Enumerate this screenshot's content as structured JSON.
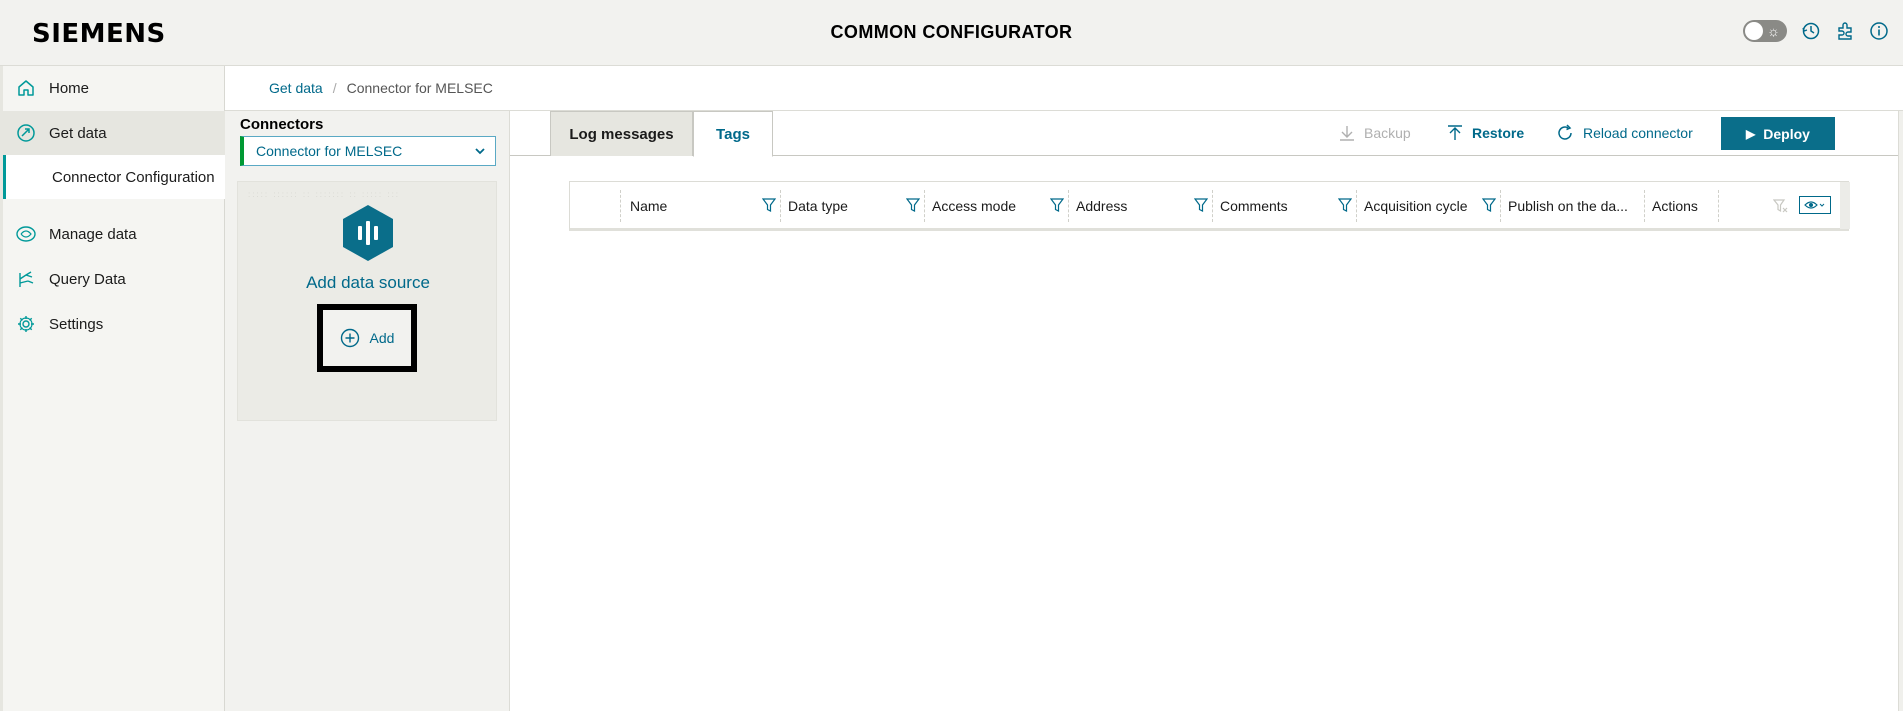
{
  "header": {
    "logo": "SIEMENS",
    "title": "COMMON CONFIGURATOR",
    "icons": [
      "theme-toggle",
      "history-icon",
      "plugin-icon",
      "info-icon"
    ]
  },
  "sidebar": {
    "items": [
      {
        "label": "Home",
        "icon": "home-icon"
      },
      {
        "label": "Get data",
        "icon": "get-data-icon",
        "active": true
      },
      {
        "label": "Connector Configuration",
        "sub": true,
        "selected": true
      },
      {
        "label": "Manage data",
        "icon": "manage-data-icon"
      },
      {
        "label": "Query Data",
        "icon": "query-data-icon"
      },
      {
        "label": "Settings",
        "icon": "settings-icon"
      }
    ]
  },
  "breadcrumb": {
    "parent": "Get data",
    "current": "Connector for MELSEC"
  },
  "connectors": {
    "title": "Connectors",
    "selected": "Connector for MELSEC",
    "card": {
      "label": "Add data source",
      "add_label": "Add"
    }
  },
  "tabs": {
    "log_messages": "Log messages",
    "tags": "Tags",
    "active": "Tags"
  },
  "toolbar": {
    "backup": "Backup",
    "restore": "Restore",
    "reload": "Reload connector",
    "deploy": "Deploy"
  },
  "table": {
    "columns": [
      "Name",
      "Data type",
      "Access mode",
      "Address",
      "Comments",
      "Acquisition cycle",
      "Publish on the da...",
      "Actions"
    ],
    "rows": []
  },
  "colors": {
    "accent": "#00698a",
    "deploy_bg": "#0a6e8a",
    "active_bar": "#009999",
    "select_bar": "#009933"
  }
}
